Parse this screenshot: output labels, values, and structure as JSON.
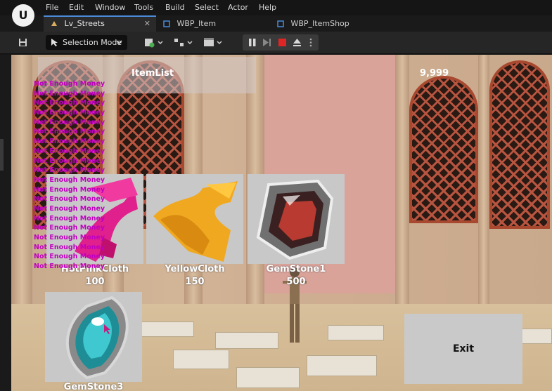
{
  "menu": {
    "logo": "U",
    "items": [
      "File",
      "Edit",
      "Window",
      "Tools",
      "Build",
      "Select",
      "Actor",
      "Help"
    ]
  },
  "tabs": [
    {
      "label": "Lv_Streets",
      "active": true
    },
    {
      "label": "WBP_Item",
      "active": false
    },
    {
      "label": "WBP_ItemShop",
      "active": false
    }
  ],
  "toolbar": {
    "mode_label": "Selection Mode"
  },
  "shop": {
    "title": "ItemList",
    "money": "9,999",
    "exit_label": "Exit",
    "items": [
      {
        "name": "HotPinkCloth",
        "price": "100",
        "icon": "pink-cloth-icon"
      },
      {
        "name": "YellowCloth",
        "price": "150",
        "icon": "yellow-cloth-icon"
      },
      {
        "name": "GemStone1",
        "price": "500",
        "icon": "gemstone-red-icon"
      },
      {
        "name": "GemStone3",
        "price": "",
        "icon": "gemstone-cyan-icon"
      }
    ]
  },
  "messages": [
    "Not Enough Money",
    "Not Enough Money",
    "Not Enough Money",
    "Not Enough Money",
    "Not Enough Money",
    "Not Enough Money",
    "Not Enough Money",
    "Not Enough Money",
    "Not Enough Money",
    "Not Enough Money",
    "Not Enough Money",
    "Not Enough Money",
    "Not Enough Money",
    "Not Enough Money",
    "Not Enough Money",
    "Not Enough Money",
    "Not Enough Money",
    "Not Enough Money",
    "Not Enough Money",
    "Not Enough Money"
  ],
  "colors": {
    "message": "#c000c0",
    "accent": "#4a8ad8"
  }
}
